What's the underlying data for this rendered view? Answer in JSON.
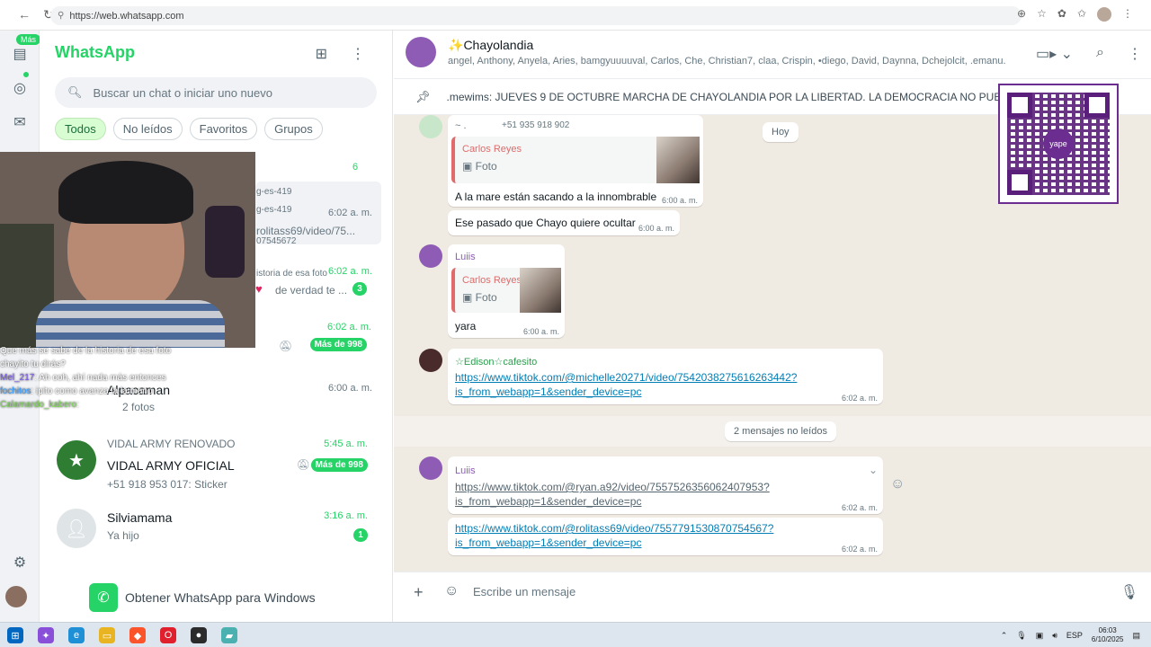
{
  "browser": {
    "url": "https://web.whatsapp.com",
    "icons": [
      "back-icon",
      "reload-icon",
      "star-icon",
      "extensions-icon",
      "profile-icon",
      "menu-icon"
    ]
  },
  "rail": {
    "badge": "Más"
  },
  "list": {
    "title": "WhatsApp",
    "search_placeholder": "Buscar un chat o iniciar uno nuevo",
    "filters": [
      "Todos",
      "No leídos",
      "Favoritos",
      "Grupos"
    ],
    "peek": {
      "count6": "6",
      "frag1": "g-es-419",
      "frag2": "g-es-419",
      "time1": "6:02 a. m.",
      "prev1": "rolitass69/video/75...",
      "prev1b": "07545672",
      "frag3": "istoria de esa foto",
      "time2": "6:02 a. m.",
      "prev2": "de verdad te ...",
      "badge2": "3",
      "time3": "6:02 a. m.",
      "badge3": "Más de 998",
      "name4": "Alpacaman",
      "time4": "6:00 a. m.",
      "prev4": "2 fotos"
    },
    "chats": [
      {
        "label_top": "VIDAL ARMY RENOVADO",
        "name": "VIDAL ARMY OFICIAL",
        "preview": "+51 918 953 017: Sticker",
        "time": "5:45 a. m.",
        "badge": "Más de 998"
      },
      {
        "name": "Silviamama",
        "preview": "Ya hijo",
        "time": "3:16 a. m.",
        "badge": "1"
      }
    ],
    "get_whatsapp": "Obtener WhatsApp para Windows"
  },
  "stream_chat": [
    {
      "user": "",
      "text": "Que más se sabe de la historia de esa foto"
    },
    {
      "user": "",
      "text": "chayito tu dirás?"
    },
    {
      "user": "Mel_217",
      "text": ": Ah ooh, ahí nada más entonces"
    },
    {
      "user": "fochitos",
      "text": ": ipito como avanza la la mano"
    },
    {
      "user": "Calamardo_kabero",
      "text": ":"
    }
  ],
  "conversation": {
    "group_name": "Chayolandia",
    "members": "angel, Anthony, Anyela, Aries, bamgyuuuuval, Carlos, Che, Christian7, claa, Crispin, •diego, David, Daynna, Dchejolcit, .emanu...",
    "pinned": ".mewims:  JUEVES 9 DE OCTUBRE MARCHA DE CHAYOLANDIA POR LA LIBERTAD. LA DEMOCRACIA NO PUEDE VERS",
    "hoy": "Hoy",
    "unread_label": "2 mensajes no leídos",
    "msg1": {
      "phone": "+51 935 918 902",
      "sender_prefix": "~ .",
      "quote_name": "Carlos Reyes",
      "quote_type": "Foto",
      "text": "A la mare están sacando a la innombrable",
      "time": "6:00 a. m."
    },
    "msg2": {
      "text": "Ese pasado que Chayo quiere ocultar",
      "time": "6:00 a. m."
    },
    "msg3": {
      "sender": "Luiis",
      "quote_name": "Carlos Reyes",
      "quote_type": "Foto",
      "text": "yara",
      "time": "6:00 a. m."
    },
    "msg4": {
      "sender": "☆Edison☆cafesito",
      "link1": "https://www.tiktok.com/@michelle20271/video/7542038275616263442?",
      "link2": "is_from_webapp=1&sender_device=pc",
      "time": "6:02 a. m."
    },
    "msg5": {
      "sender": "Luiis",
      "link1": "https://www.tiktok.com/@ryan.a92/video/7557526356062407953?",
      "link2": "is_from_webapp=1&sender_device=pc",
      "time": "6:02 a. m."
    },
    "msg6": {
      "link1": "https://www.tiktok.com/@rolitass69/video/7557791530870754567?",
      "link2": "is_from_webapp=1&sender_device=pc",
      "time": "6:02 a. m."
    },
    "qr_label": "yape",
    "composer_placeholder": "Escribe un mensaje"
  },
  "taskbar": {
    "lang": "ESP",
    "time": "06:03",
    "date": "6/10/2025"
  },
  "colors": {
    "brand_green": "#25d366",
    "link": "#027eb5",
    "chat_bg": "#efeae2",
    "quote_accent": "#e16a6a"
  }
}
